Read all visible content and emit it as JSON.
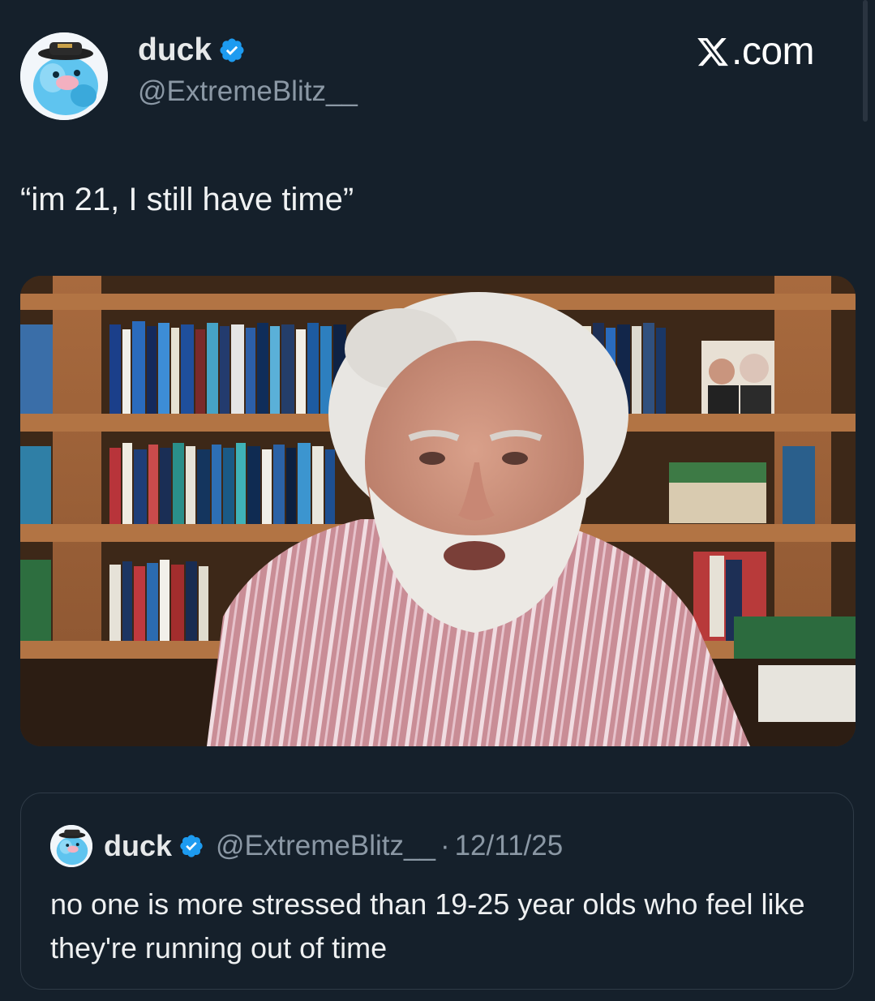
{
  "post": {
    "display_name": "duck",
    "handle": "@ExtremeBlitz__",
    "verified_icon": "verified-badge-icon",
    "text": "“im 21, I still have time”"
  },
  "brand": {
    "label": ".com",
    "icon": "x-logo-icon"
  },
  "media": {
    "icon": "photo-bookshelf-scene"
  },
  "quoted_post": {
    "display_name": "duck",
    "handle": "@ExtremeBlitz__",
    "separator": "·",
    "date": "12/11/25",
    "text": "no one is more stressed than 19-25 year olds who feel like they're running out of time"
  },
  "colors": {
    "background": "#15202b",
    "verified_blue": "#1d9bf0",
    "secondary_text": "#8b98a5"
  }
}
